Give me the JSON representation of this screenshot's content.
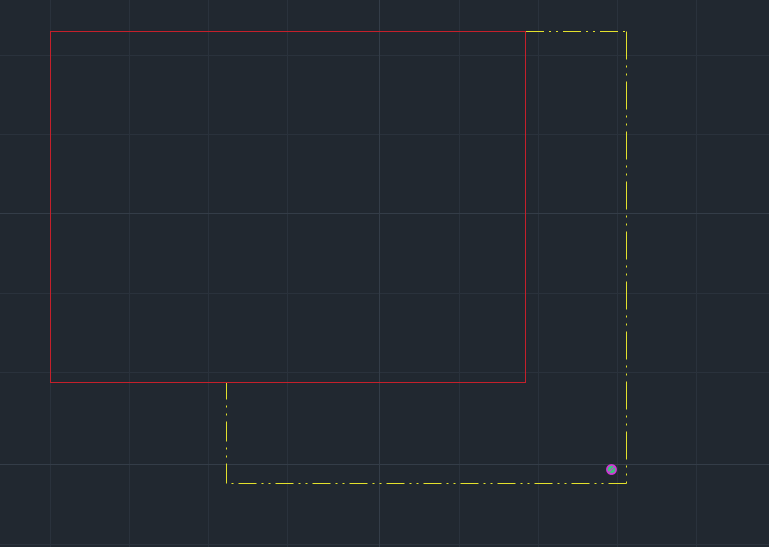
{
  "canvas": {
    "background": "#212830",
    "grid": {
      "visible": true,
      "minor_color": "#2a323c",
      "major_color": "#343d48"
    }
  },
  "entities": {
    "rectangle": {
      "color": "#c4202b",
      "linetype": "continuous"
    },
    "polyline": {
      "color": "#e3e12c",
      "linetype": "dash-dot-dot"
    }
  },
  "ucs_icon": {
    "icon": "snap-marker-icon",
    "fill_color": "#3dc47a",
    "ring_color": "#d235d8"
  }
}
